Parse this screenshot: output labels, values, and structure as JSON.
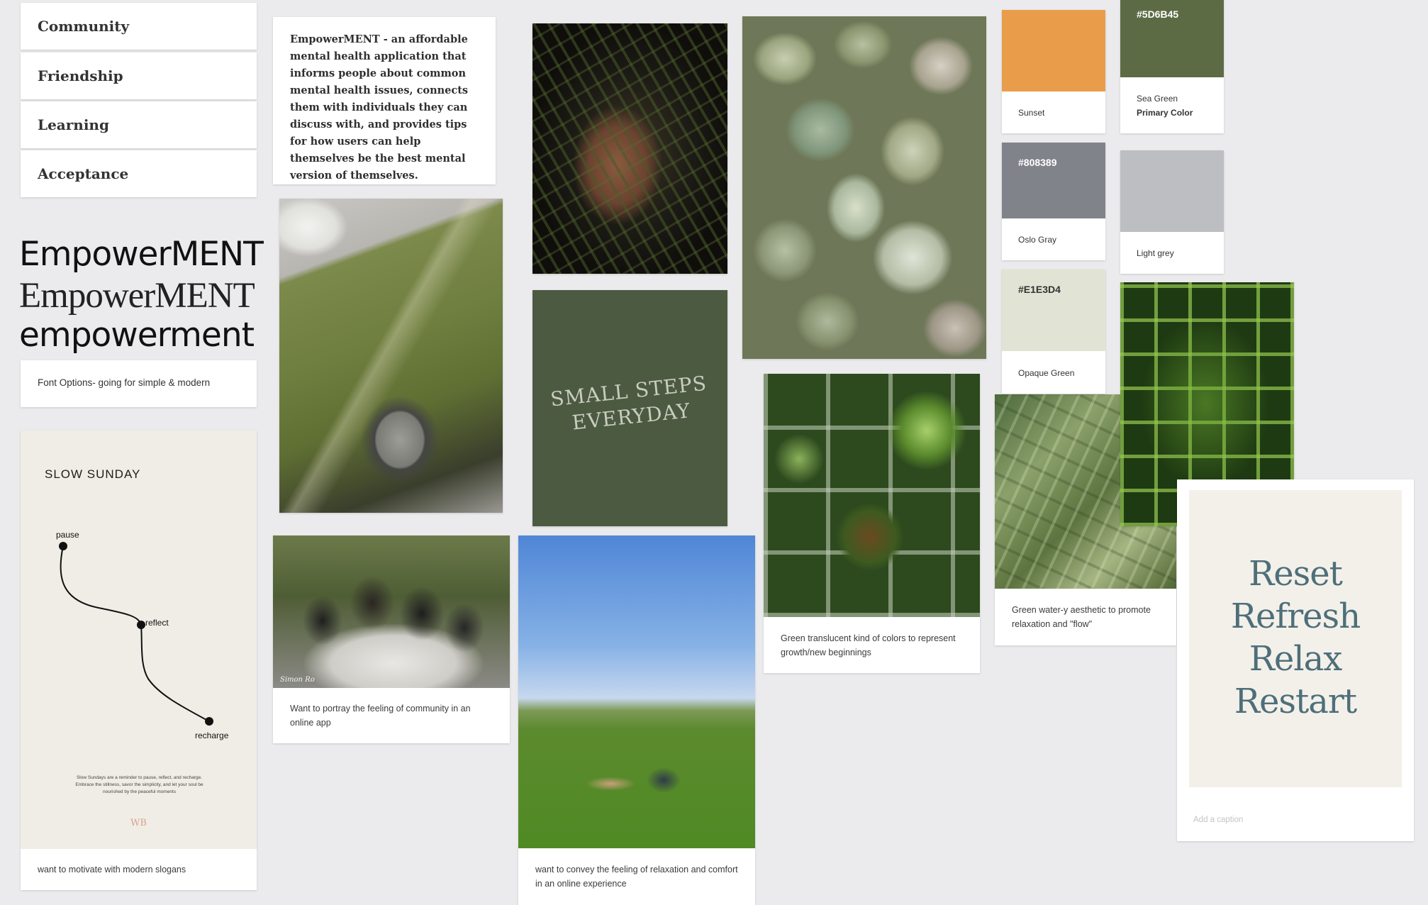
{
  "values": [
    "Community",
    "Friendship",
    "Learning",
    "Acceptance"
  ],
  "mission": {
    "text": "EmpowerMENT - an affordable mental health application that informs people about common mental health issues, connects them with individuals they can discuss with, and provides tips for how users can help themselves be the best mental version of themselves."
  },
  "fonts": {
    "sample_1": "EmpowerMENT",
    "sample_2": "EmpowerMENT",
    "sample_3": "empowerment",
    "caption": "Font Options- going for simple & modern"
  },
  "slow_sunday": {
    "title": "SLOW SUNDAY",
    "step_1": "pause",
    "step_2": "reflect",
    "step_3": "recharge",
    "body": "Slow Sundays are a reminder to pause, reflect, and recharge. Embrace the stillness, savor the simplicity, and let your soul be nourished by the peaceful moments",
    "mark": "WB",
    "caption": "want to motivate with modern slogans"
  },
  "slogan": {
    "line_1": "SMALL STEPS",
    "line_2": "EVERYDAY"
  },
  "captions": {
    "community": "Want to portray the feeling of community in an online app",
    "relaxation": "want to convey the feeling of relaxation and comfort in an online experience",
    "translucent": "Green translucent kind of colors to represent growth/new beginnings",
    "water": "Green water-y aesthetic to promote relaxation and \"flow\""
  },
  "hug_watermark": "Simon Ro",
  "palette": {
    "sunset": {
      "name": "Sunset",
      "color": "#E99D4B"
    },
    "sea_green": {
      "hex": "#5D6B45",
      "name": "Sea Green",
      "role": "Primary Color",
      "color": "#5D6B45"
    },
    "oslo_gray": {
      "hex": "#808389",
      "name": "Oslo Gray",
      "color": "#808389"
    },
    "light_grey": {
      "name": "Light grey",
      "color": "#BDBEC2"
    },
    "opaque_green": {
      "hex": "#E1E3D4",
      "name": "Opaque Green",
      "color": "#E1E3D4"
    }
  },
  "affirmation": {
    "line_1": "Reset",
    "line_2": "Refresh",
    "line_3": "Relax",
    "line_4": "Restart",
    "caption_placeholder": "Add a caption"
  }
}
